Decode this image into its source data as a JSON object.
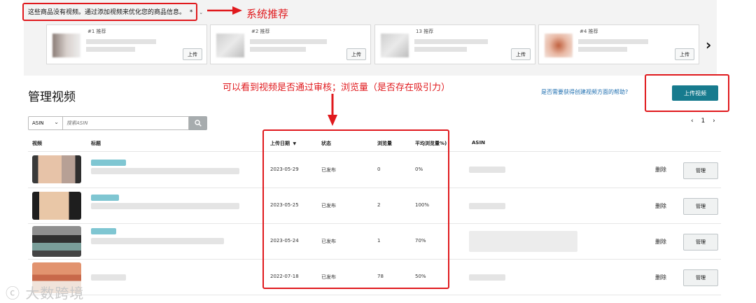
{
  "recommendations": {
    "message": "这些商品没有视频。通过添加视频来优化您的商品信息。",
    "message_suffix": "*",
    "cards": [
      {
        "rank": "#1 推荐",
        "upload_label": "上传"
      },
      {
        "rank": "#2 推荐",
        "upload_label": "上传"
      },
      {
        "rank": "13 推荐",
        "upload_label": "上传"
      },
      {
        "rank": "#4 推荐",
        "upload_label": "上传"
      }
    ]
  },
  "annotations": {
    "system_recommend": "系统推荐",
    "review_note": "可以看到视频是否通过审核；浏览量（是否存在吸引力）"
  },
  "header": {
    "title": "管理视频",
    "help_link": "是否需要获得创建视频方面的帮助?",
    "upload_button": "上传视频"
  },
  "search": {
    "filter_value": "ASIN",
    "placeholder": "搜索ASIN"
  },
  "pagination": {
    "prev": "‹",
    "page": "1",
    "next": "›"
  },
  "table": {
    "headers": {
      "video": "视频",
      "title": "标题",
      "upload_date": "上传日期",
      "status": "状态",
      "views": "浏览量",
      "avg_views": "平均浏览量",
      "avg_views_suffix": "%)",
      "asin": "ASIN"
    },
    "rows": [
      {
        "date": "2023-05-29",
        "status": "已发布",
        "views": "0",
        "avg": "0%",
        "delete": "删除",
        "manage": "管理"
      },
      {
        "date": "2023-05-25",
        "status": "已发布",
        "views": "2",
        "avg": "100%",
        "delete": "删除",
        "manage": "管理"
      },
      {
        "date": "2023-05-24",
        "status": "已发布",
        "views": "1",
        "avg": "70%",
        "delete": "删除",
        "manage": "管理"
      },
      {
        "date": "2022-07-18",
        "status": "已发布",
        "views": "78",
        "avg": "50%",
        "delete": "删除",
        "manage": "管理"
      }
    ]
  },
  "watermark": "大数跨境",
  "colors": {
    "accent": "#177b8e",
    "annotation": "#e0191d",
    "link": "#1f6fb0"
  }
}
